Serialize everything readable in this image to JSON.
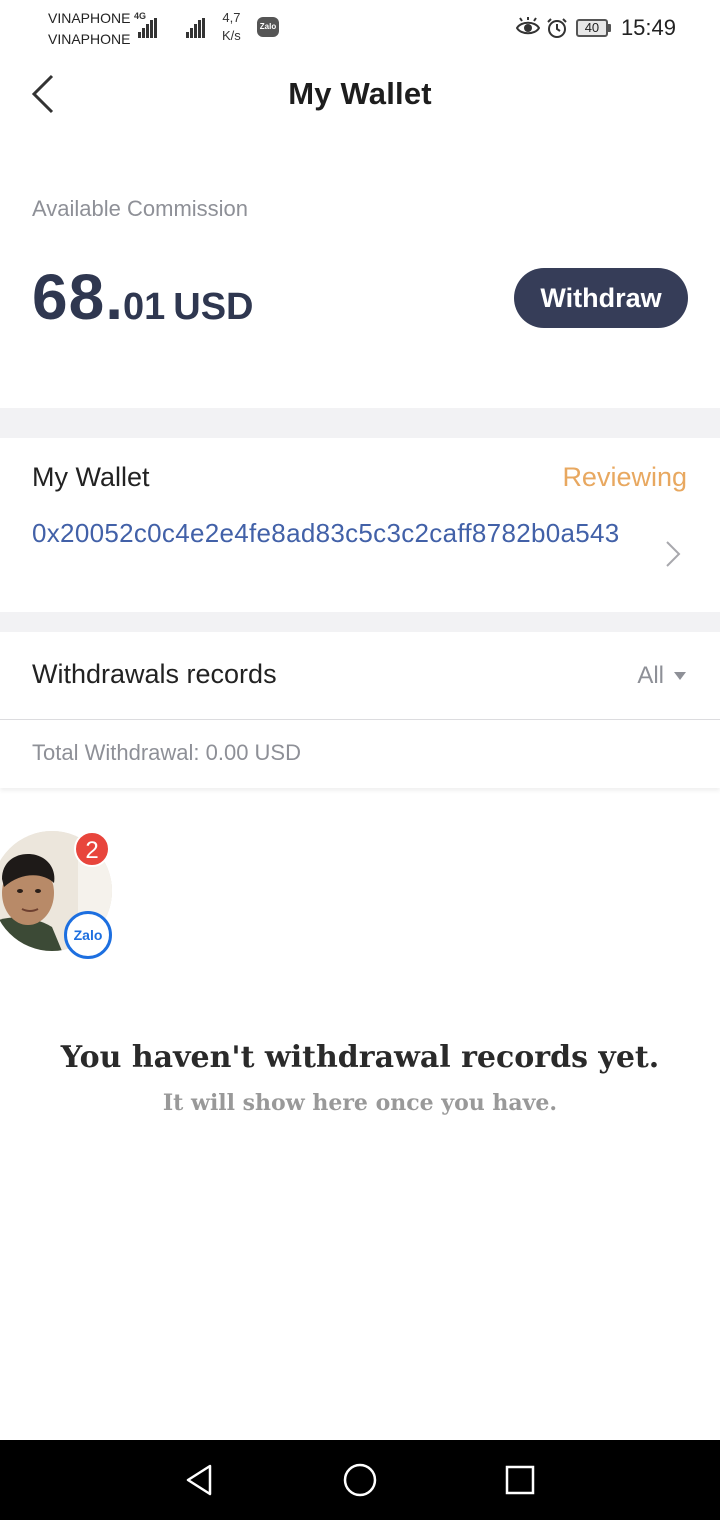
{
  "status_bar": {
    "carrier_1": "VINAPHONE",
    "carrier_2": "VINAPHONE",
    "network_type": "4G",
    "speed_value": "4,7",
    "speed_unit": "K/s",
    "notification_app": "Zalo",
    "battery_level": "40",
    "time": "15:49"
  },
  "header": {
    "title": "My Wallet",
    "back_icon": "chevron-left-icon"
  },
  "commission": {
    "label": "Available Commission",
    "amount_integer": "68",
    "amount_separator": ".",
    "amount_decimal": "01",
    "currency": "USD",
    "withdraw_button": "Withdraw",
    "accent_color": "#363d58"
  },
  "wallet": {
    "label": "My Wallet",
    "status": "Reviewing",
    "status_color": "#e8a860",
    "address": "0x20052c0c4e2e4fe8ad83c5c3c2caff8782b0a543",
    "address_color": "#4261a8"
  },
  "records": {
    "title": "Withdrawals records",
    "filter_selected": "All",
    "total_text": "Total Withdrawal: 0.00 USD"
  },
  "chat_head": {
    "badge_count": "2",
    "app_label": "Zalo"
  },
  "empty_state": {
    "title": "You haven't withdrawal records yet.",
    "subtitle": "It will show here once you have."
  },
  "nav_bar": {
    "back_icon": "triangle-back-icon",
    "home_icon": "circle-home-icon",
    "recents_icon": "square-recents-icon"
  }
}
